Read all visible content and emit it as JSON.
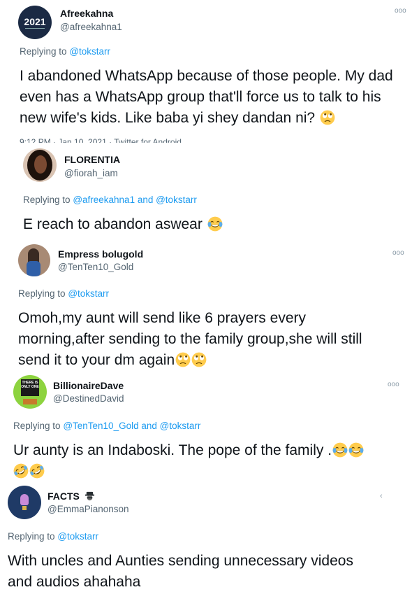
{
  "tweets": [
    {
      "name": "Afreekahna",
      "handle": "@afreekahna1",
      "avatar_text": "2021",
      "reply_prefix": "Replying to",
      "reply_mentions": "@tokstarr",
      "text": "I abandoned WhatsApp because of those people. My dad even has a WhatsApp group that'll force us to talk to his new wife's kids. Like baba yi shey dandan ni?",
      "emojis": [
        "rolling-eyes"
      ],
      "timestamp_partial": "9:12 PM · Jan 10, 2021 · Twitter for Android"
    },
    {
      "name": "FLORENTIA",
      "handle": "@fiorah_iam",
      "reply_prefix": "Replying to",
      "reply_mentions": "@afreekahna1 and @tokstarr",
      "text": "E reach to abandon aswear",
      "emojis": [
        "tears-of-joy"
      ]
    },
    {
      "name": "Empress bolugold",
      "handle": "@TenTen10_Gold",
      "reply_prefix": "Replying to",
      "reply_mentions": "@tokstarr",
      "text_lines": [
        "Omoh,my aunt will send like 6 prayers every",
        "morning,after sending to the family group,she will still",
        "send it to your dm again"
      ],
      "emojis": [
        "rolling-eyes",
        "rolling-eyes"
      ]
    },
    {
      "name": "BillionaireDave",
      "handle": "@DestinedDavid",
      "avatar_text": "THERE IS ONLY ONE",
      "reply_prefix": "Replying to",
      "reply_mentions": "@TenTen10_Gold and @tokstarr",
      "text": "Ur aunty is an Indaboski. The pope of the family .",
      "emojis": [
        "tears-of-joy",
        "tears-of-joy",
        "rofl",
        "rofl"
      ]
    },
    {
      "name": "FACTS",
      "handle": "@EmmaPianonson",
      "reply_prefix": "Replying to",
      "reply_mentions": "@tokstarr",
      "text_lines": [
        "With uncles and Aunties sending unnecessary videos",
        "and audios ahahaha"
      ]
    }
  ],
  "icons": {
    "more": "more-horizontal-icon",
    "rolling_eyes": "rolling-eyes-emoji",
    "tears_of_joy": "tears-of-joy-emoji",
    "rofl": "rofl-emoji",
    "spy": "detective-emoji"
  },
  "colors": {
    "link": "#1d9bf0",
    "secondary": "#536471",
    "text": "#0f1419",
    "emoji_yellow": "#ffcc4d"
  }
}
